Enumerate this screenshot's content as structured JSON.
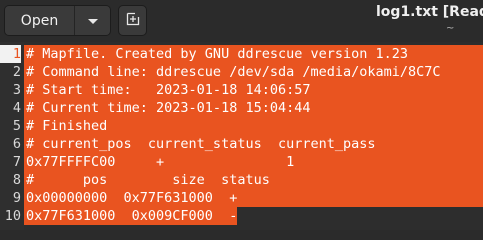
{
  "header": {
    "open_label": "Open",
    "open_menu_icon": "chevron-down-icon",
    "new_document_icon": "new-tab-icon",
    "title": "log1.txt [Read-",
    "subtitle": "~"
  },
  "editor": {
    "selection_color": "#E95420",
    "lines": [
      {
        "num": "1",
        "text": "# Mapfile. Created by GNU ddrescue version 1.23"
      },
      {
        "num": "2",
        "text": "# Command line: ddrescue /dev/sda /media/okami/8C7C"
      },
      {
        "num": "3",
        "text": "# Start time:   2023-01-18 14:06:57"
      },
      {
        "num": "4",
        "text": "# Current time: 2023-01-18 15:04:44"
      },
      {
        "num": "5",
        "text": "# Finished"
      },
      {
        "num": "6",
        "text": "# current_pos  current_status  current_pass"
      },
      {
        "num": "7",
        "text": "0x77FFFFC00     +               1"
      },
      {
        "num": "8",
        "text": "#      pos        size  status"
      },
      {
        "num": "9",
        "text": "0x00000000  0x77F631000  +"
      },
      {
        "num": "10",
        "text": "0x77F631000  0x009CF000  -"
      }
    ]
  }
}
